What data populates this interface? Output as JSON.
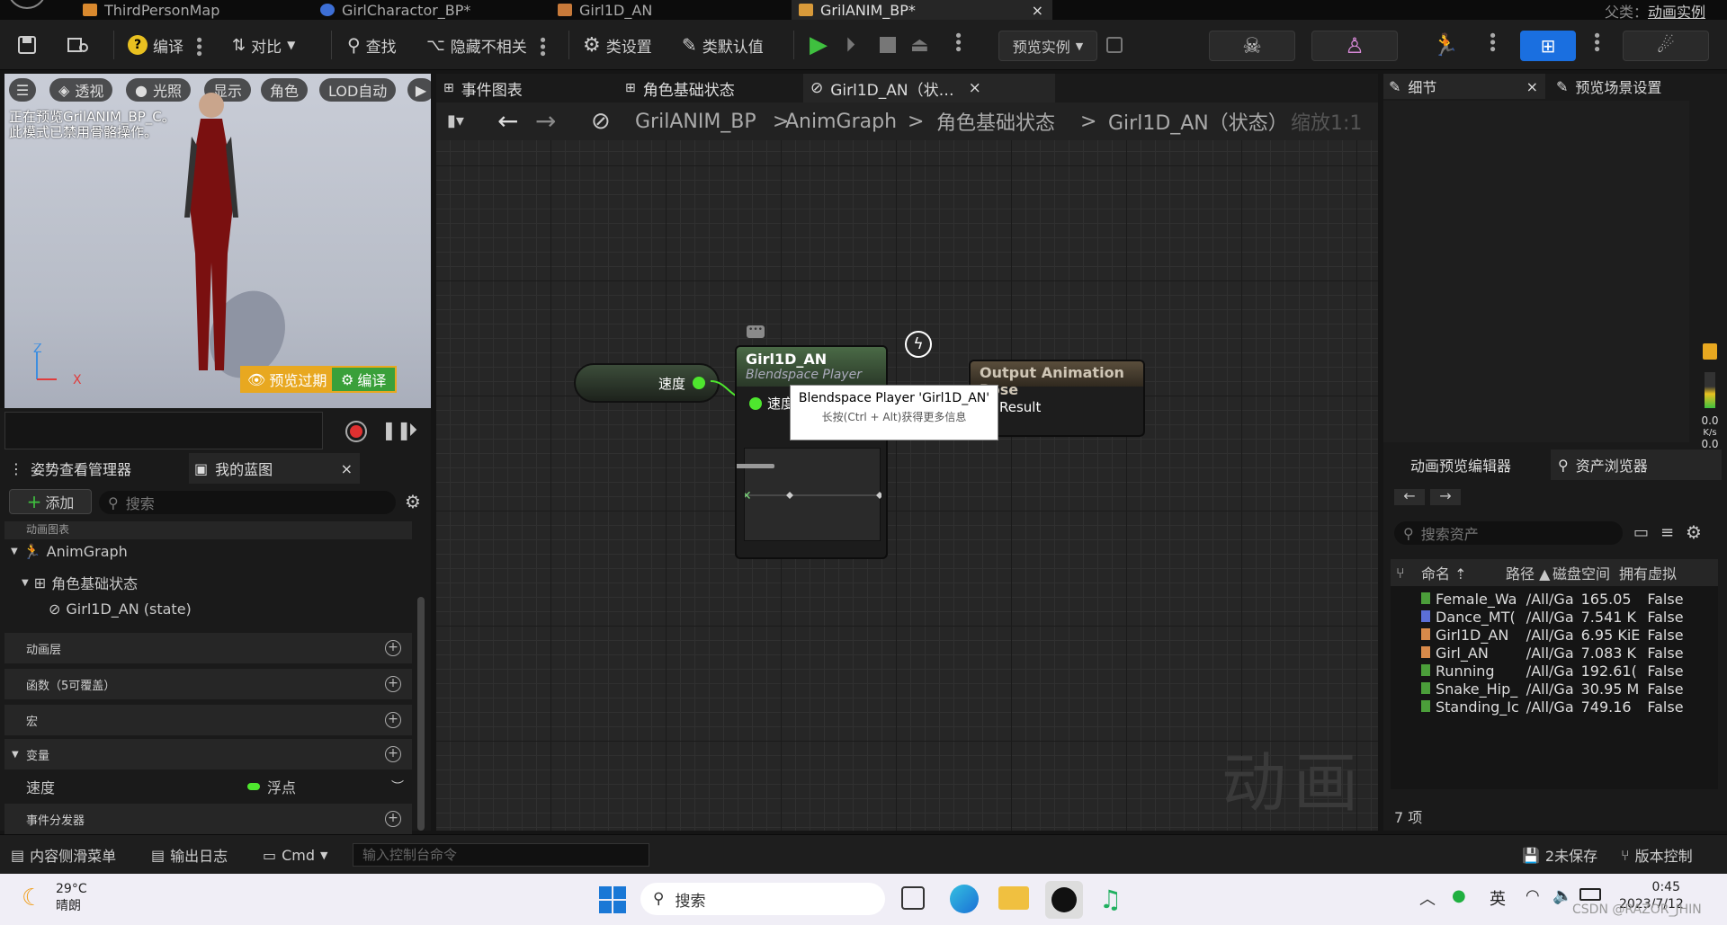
{
  "tabs": [
    {
      "label": "ThirdPersonMap"
    },
    {
      "label": "GirlCharactor_BP*"
    },
    {
      "label": "Girl1D_AN"
    },
    {
      "label": "GrilANIM_BP*"
    }
  ],
  "tab_right": {
    "parent_label": "父类：",
    "parent_value": "动画实例"
  },
  "toolbar": {
    "compile": "编译",
    "diff": "对比",
    "find": "查找",
    "hide_unrelated": "隐藏不相关",
    "class_settings": "类设置",
    "class_defaults": "类默认值",
    "preview_instance": "预览实例"
  },
  "viewport": {
    "buttons": [
      "透视",
      "光照",
      "显示",
      "角色",
      "LOD自动"
    ],
    "info_line1": "正在预览GrilANIM_BP_C。",
    "info_line2": "此模式已禁用骨骼操作。",
    "preview_expired": "预览过期",
    "compile": "编译",
    "axis_z": "Z",
    "axis_x": "X"
  },
  "left_panel": {
    "tab1": "姿势查看管理器",
    "tab2": "我的蓝图",
    "add": "添加",
    "search_placeholder": "搜索",
    "section_anim_graph": "动画图表",
    "tree": [
      {
        "label": "AnimGraph"
      },
      {
        "label": "角色基础状态"
      },
      {
        "label": "Girl1D_AN (state)"
      }
    ],
    "sections": [
      {
        "label": "动画层"
      },
      {
        "label": "函数（5可覆盖）"
      },
      {
        "label": "宏"
      },
      {
        "label": "变量"
      }
    ],
    "variable": {
      "name": "速度",
      "type": "浮点"
    },
    "event_dispatchers": "事件分发器"
  },
  "graph_tabs": [
    {
      "label": "事件图表"
    },
    {
      "label": "角色基础状态"
    },
    {
      "label": "Girl1D_AN（状…"
    }
  ],
  "breadcrumb": {
    "root": "GrilANIM_BP",
    "p1": "AnimGraph",
    "p2": "角色基础状态",
    "p3": "Girl1D_AN（状态）",
    "zoom": "缩放1:1"
  },
  "graph": {
    "var_node_label": "速度",
    "bs_title": "Girl1D_AN",
    "bs_subtitle": "Blendspace Player",
    "bs_pin": "速度",
    "output_title": "Output Animation Pose",
    "output_pin": "Result",
    "tooltip_title": "Blendspace Player 'Girl1D_AN'",
    "tooltip_hint": "长按(Ctrl + Alt)获得更多信息",
    "watermark": "动画"
  },
  "right_panel": {
    "tab_details": "细节",
    "tab_preview_scene": "预览场景设置",
    "tab_anim_preview": "动画预览编辑器",
    "tab_asset_browser": "资产浏览器",
    "search_placeholder": "搜索资产",
    "columns": [
      "命名",
      "路径",
      "磁盘空间",
      "拥有虚拟"
    ],
    "assets": [
      {
        "name": "Female_Wa",
        "path": "/All/Ga",
        "size": "165.05",
        "virtual": "False",
        "color": "#4b9e3a"
      },
      {
        "name": "Dance_MT(",
        "path": "/All/Ga",
        "size": "7.541 K",
        "virtual": "False",
        "color": "#5b6fd6"
      },
      {
        "name": "Girl1D_AN",
        "path": "/All/Ga",
        "size": "6.95 KiE",
        "virtual": "False",
        "color": "#d88a4a"
      },
      {
        "name": "Girl_AN",
        "path": "/All/Ga",
        "size": "7.083 K",
        "virtual": "False",
        "color": "#d88a4a"
      },
      {
        "name": "Running",
        "path": "/All/Ga",
        "size": "192.61(",
        "virtual": "False",
        "color": "#4b9e3a"
      },
      {
        "name": "Snake_Hip_",
        "path": "/All/Ga",
        "size": "30.95 M",
        "virtual": "False",
        "color": "#4b9e3a"
      },
      {
        "name": "Standing_Ic",
        "path": "/All/Ga",
        "size": "749.16",
        "virtual": "False",
        "color": "#4b9e3a"
      }
    ],
    "item_count": "7 项",
    "stat1": "0.0",
    "stat2": "0.0",
    "unit": "K/s"
  },
  "statusbar": {
    "content_drawer": "内容侧滑菜单",
    "output_log": "输出日志",
    "cmd": "Cmd",
    "console_placeholder": "输入控制台命令",
    "unsaved": "2未保存",
    "source_control": "版本控制"
  },
  "taskbar": {
    "temp": "29°C",
    "weather": "晴朗",
    "search": "搜索",
    "ime": "英",
    "time": "0:45",
    "date": "2023/7/12",
    "watermark": "CSDN @RAZOR_JHIN"
  }
}
